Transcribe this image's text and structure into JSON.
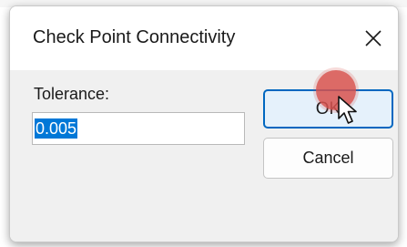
{
  "dialog": {
    "title": "Check Point Connectivity",
    "close_icon": "close-icon"
  },
  "form": {
    "tolerance_label": "Tolerance:",
    "tolerance_value": "0.005"
  },
  "buttons": {
    "ok_label": "OK",
    "cancel_label": "Cancel"
  },
  "colors": {
    "ok_border": "#0067c0",
    "selection": "#0078d7",
    "click_marker": "#d9534f"
  }
}
